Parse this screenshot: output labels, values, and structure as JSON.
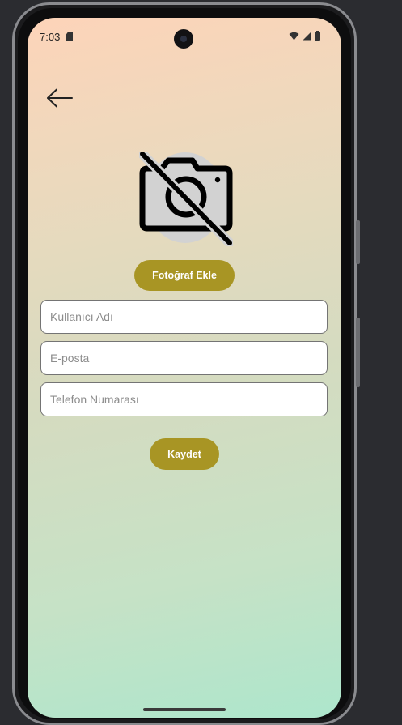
{
  "status_bar": {
    "time": "7:03",
    "icons": [
      "sim-card-icon",
      "wifi-icon",
      "signal-icon",
      "battery-icon"
    ]
  },
  "header": {
    "back_icon": "arrow-left-icon"
  },
  "profile_photo": {
    "icon": "no-photography-icon"
  },
  "buttons": {
    "add_photo_label": "Fotoğraf Ekle",
    "save_label": "Kaydet"
  },
  "form": {
    "username": {
      "value": "",
      "placeholder": "Kullanıcı Adı"
    },
    "email": {
      "value": "",
      "placeholder": "E-posta"
    },
    "phone": {
      "value": "",
      "placeholder": "Telefon Numarası"
    }
  },
  "colors": {
    "accent": "#a89524",
    "gradient_top": "#fdd4b9",
    "gradient_bottom": "#ade6cc",
    "field_border": "#747474"
  }
}
